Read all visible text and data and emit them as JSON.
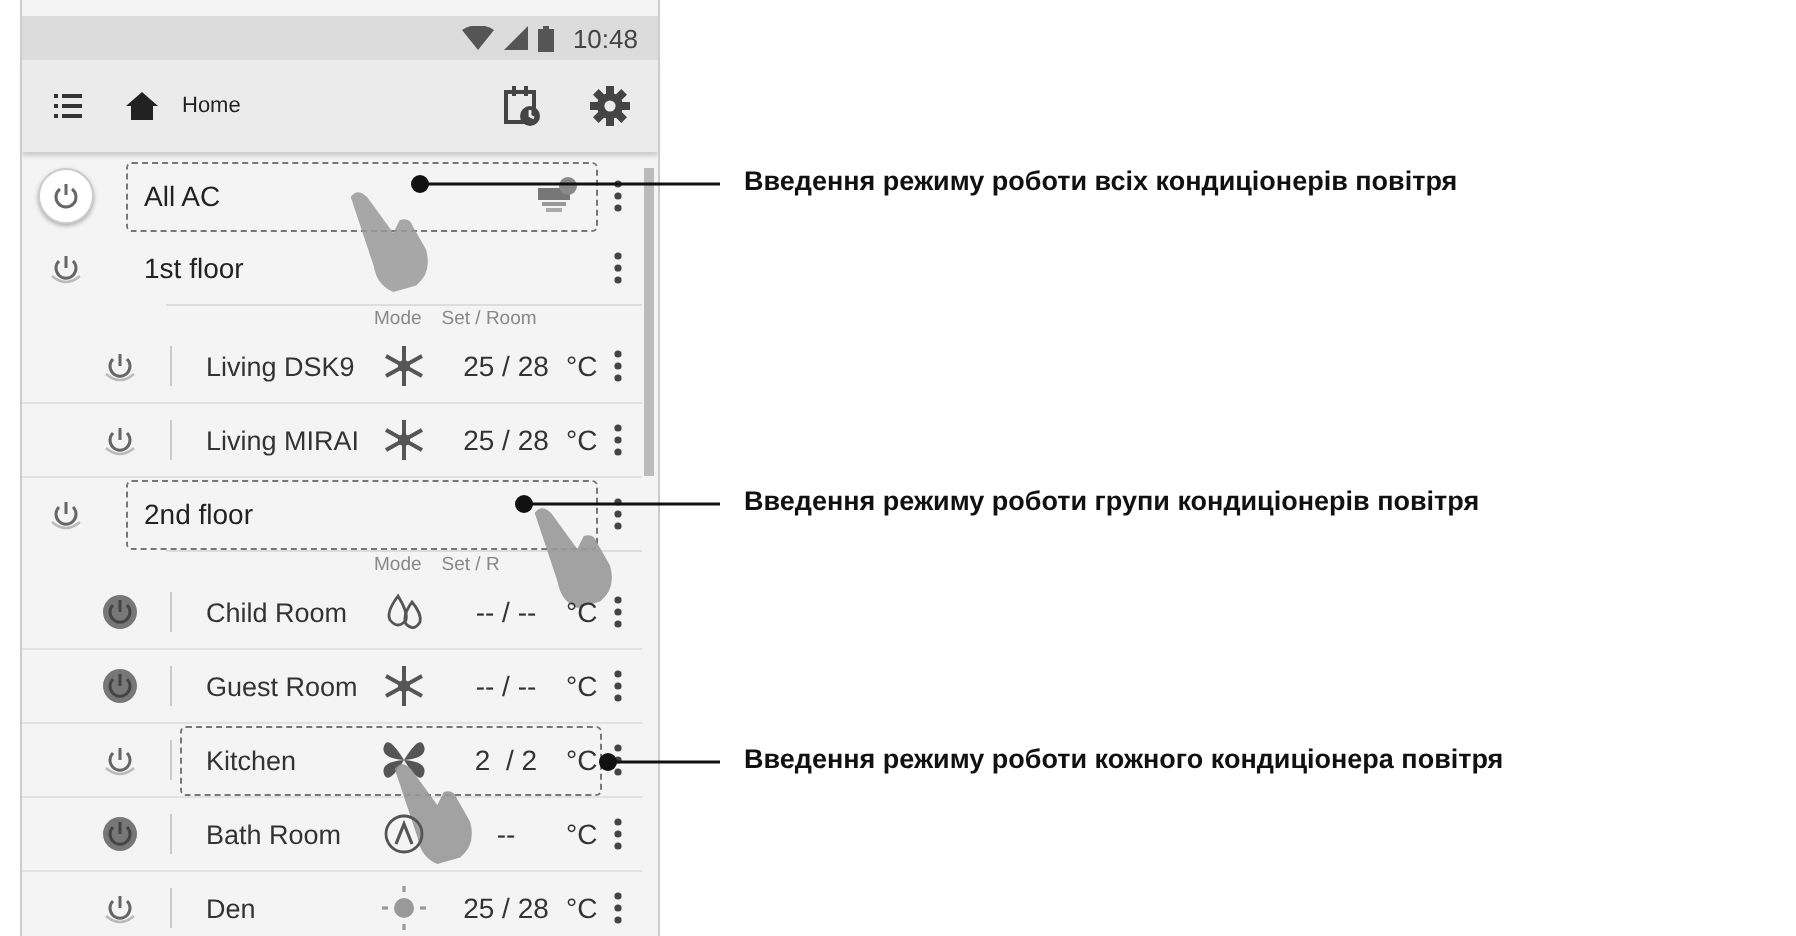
{
  "status_bar": {
    "time": "10:48"
  },
  "toolbar": {
    "title": "Home"
  },
  "all_ac": {
    "name": "All AC",
    "on": true,
    "highlighted": true
  },
  "groups": [
    {
      "name": "1st floor",
      "on": true,
      "highlighted": false,
      "header": {
        "mode": "Mode",
        "set_room": "Set / Room"
      },
      "children": [
        {
          "name": "Living DSK9",
          "on": true,
          "kind": "cool",
          "set": "25 / 28",
          "unit": "°C",
          "highlighted": false
        },
        {
          "name": "Living MIRAI",
          "on": true,
          "kind": "cool",
          "set": "25 / 28",
          "unit": "°C",
          "highlighted": false
        }
      ]
    },
    {
      "name": "2nd floor",
      "on": true,
      "highlighted": true,
      "header": {
        "mode": "Mode",
        "set_room": "Set / R"
      },
      "children": [
        {
          "name": "Child Room",
          "on": false,
          "kind": "dry",
          "set": "-- / --",
          "unit": "°C",
          "highlighted": false
        },
        {
          "name": "Guest Room",
          "on": false,
          "kind": "cool",
          "set": "-- / --",
          "unit": "°C",
          "highlighted": false
        },
        {
          "name": "Kitchen",
          "on": true,
          "kind": "fan",
          "set": "2  / 2",
          "unit": "°C",
          "highlighted": true
        },
        {
          "name": "Bath Room",
          "on": false,
          "kind": "auto",
          "set": "--",
          "unit": "°C",
          "highlighted": false
        },
        {
          "name": "Den",
          "on": true,
          "kind": "heat",
          "set": "25 / 28",
          "unit": "°C",
          "highlighted": false
        }
      ]
    }
  ],
  "annotations": [
    {
      "text": "Введення режиму роботи всіх кондиціонерів повітря"
    },
    {
      "text": "Введення режиму роботи групи кондиціонерів повітря"
    },
    {
      "text": "Введення режиму роботи кожного кондиціонера повітря"
    }
  ]
}
